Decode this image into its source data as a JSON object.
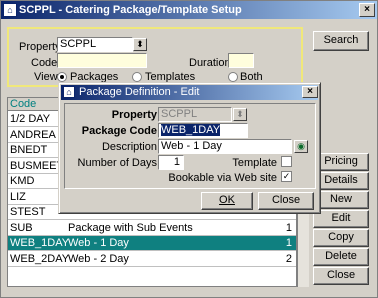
{
  "window": {
    "title": "SCPPL - Catering Package/Template Setup"
  },
  "filter": {
    "property_label": "Property",
    "property_value": "SCPPL",
    "code_label": "Code",
    "code_value": "",
    "duration_label": "Duration",
    "duration_value": "",
    "view_label": "View",
    "view_options": [
      "Packages",
      "Templates",
      "Both"
    ],
    "view_selected": "Packages"
  },
  "grid": {
    "header_code": "Code",
    "rows": [
      {
        "code": "1/2 DAY",
        "description": "",
        "days": ""
      },
      {
        "code": "ANDREA",
        "description": "",
        "days": ""
      },
      {
        "code": "BNEDT",
        "description": "",
        "days": ""
      },
      {
        "code": "BUSMEET",
        "description": "",
        "days": ""
      },
      {
        "code": "KMD",
        "description": "",
        "days": ""
      },
      {
        "code": "LIZ",
        "description": "",
        "days": ""
      },
      {
        "code": "STEST",
        "description": "",
        "days": ""
      },
      {
        "code": "SUB",
        "description": "Package with Sub Events",
        "days": "1"
      },
      {
        "code": "WEB_1DAY",
        "description": "Web - 1 Day",
        "days": "1"
      },
      {
        "code": "WEB_2DAY",
        "description": "Web - 2 Day",
        "days": "2"
      }
    ],
    "selected_index": 8
  },
  "side_buttons": {
    "search": "Search",
    "pricing": "Pricing",
    "details": "Details",
    "new": "New",
    "edit": "Edit",
    "copy": "Copy",
    "delete": "Delete",
    "close": "Close"
  },
  "dialog": {
    "title": "Package Definition - Edit",
    "property_label": "Property",
    "property_value": "SCPPL",
    "package_code_label": "Package Code",
    "package_code_value": "WEB_1DAY",
    "description_label": "Description",
    "description_value": "Web - 1 Day",
    "days_label": "Number of Days",
    "days_value": "1",
    "template_label": "Template",
    "template_checked": false,
    "bookable_label": "Bookable via Web site",
    "bookable_checked": true,
    "ok_label": "OK",
    "close_label": "Close"
  },
  "colors": {
    "title_start": "#0a246a",
    "selected_row": "#0f8080",
    "highlight_field": "#fffedd"
  }
}
